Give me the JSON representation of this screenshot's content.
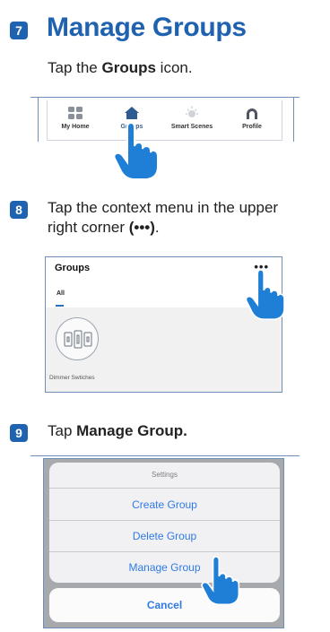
{
  "step7": {
    "number": "7",
    "title": "Manage Groups",
    "text_pre": "Tap the ",
    "text_bold": "Groups",
    "text_post": " icon."
  },
  "tabbar": {
    "tabs": [
      {
        "label": "My Home",
        "icon": "grid-icon",
        "active": false
      },
      {
        "label": "Groups",
        "icon": "house-icon",
        "active": true
      },
      {
        "label": "Smart Scenes",
        "icon": "sun-icon",
        "active": false
      },
      {
        "label": "Profile",
        "icon": "profile-icon",
        "active": false
      }
    ]
  },
  "step8": {
    "number": "8",
    "line1": "Tap the context menu in the upper",
    "line2_pre": "right corner ",
    "line2_bold": "(•••)",
    "line2_post": "."
  },
  "groups_screen": {
    "title": "Groups",
    "menu_glyph": "•••",
    "tab_all": "All",
    "card_label": "Dimmer Swtiches"
  },
  "step9": {
    "number": "9",
    "text_pre": "Tap ",
    "text_bold": "Manage Group."
  },
  "action_sheet": {
    "header": "Settings",
    "items": [
      "Create Group",
      "Delete Group",
      "Manage Group"
    ],
    "cancel": "Cancel"
  },
  "colors": {
    "accent": "#1f62b0",
    "ios_blue": "#2f7ae5",
    "rule": "#6f8fb8",
    "hand": "#1f7fd6"
  }
}
